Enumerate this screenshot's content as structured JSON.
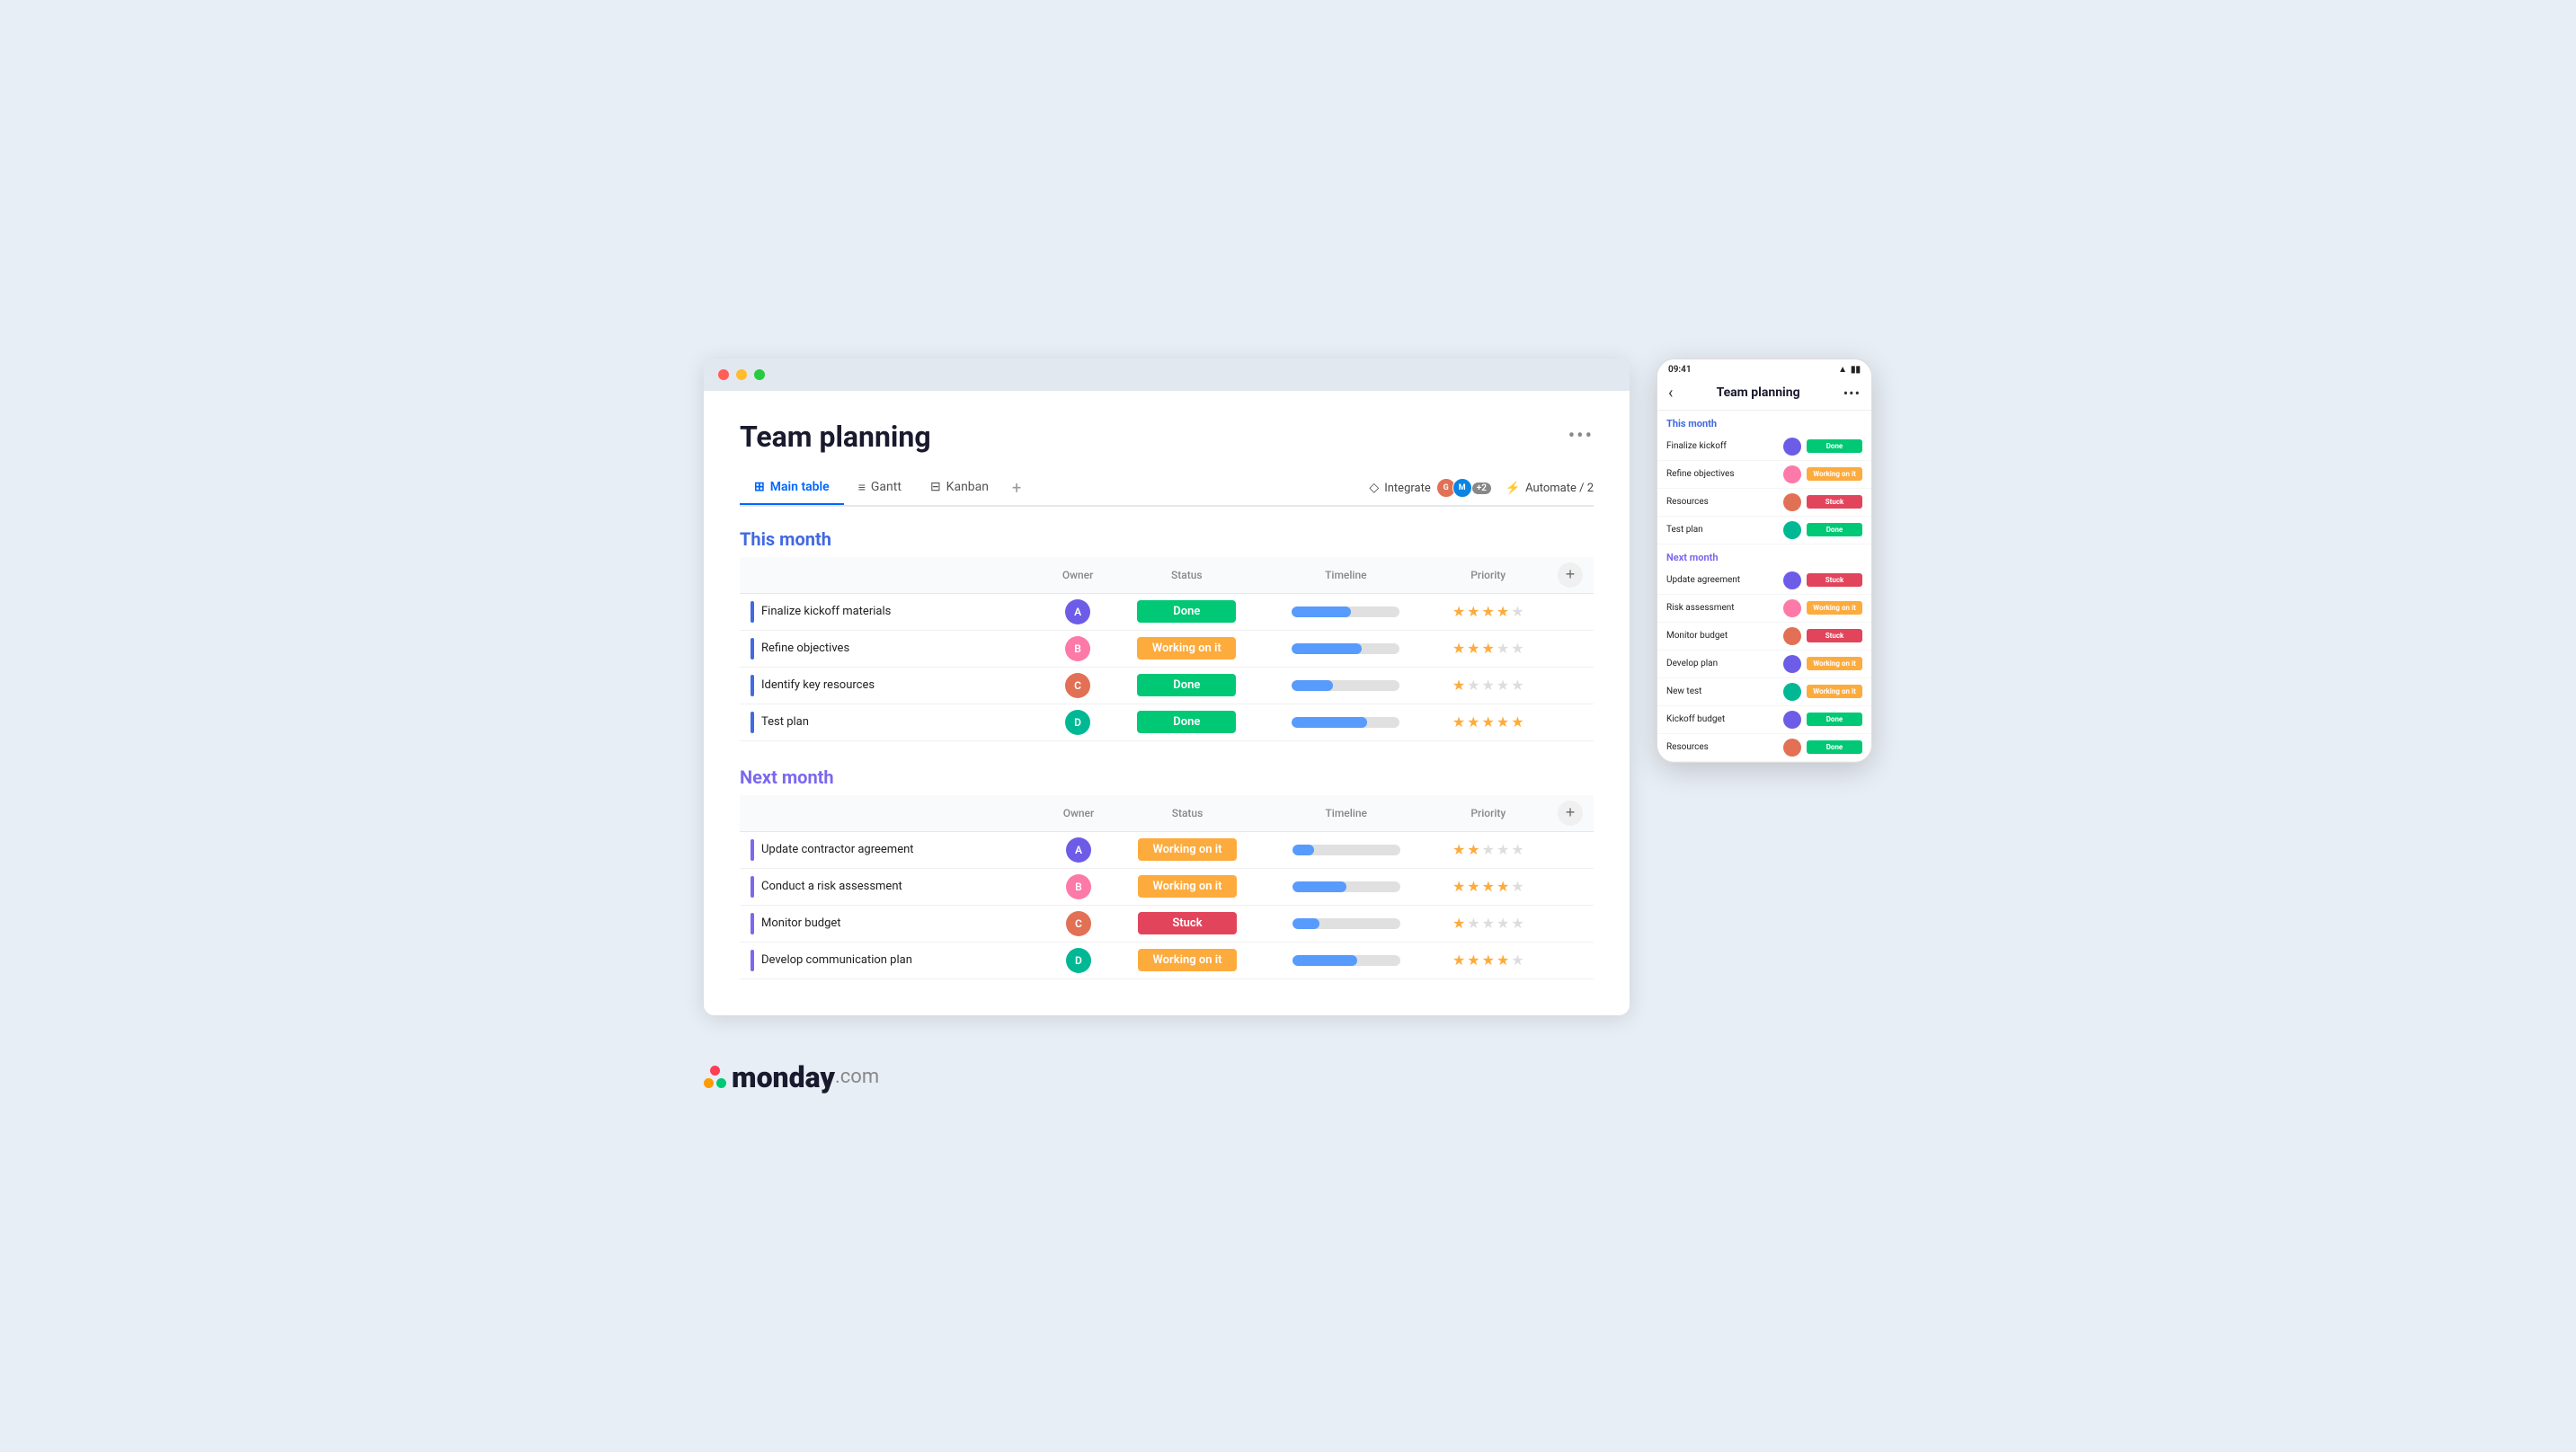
{
  "app": {
    "title": "Team planning",
    "more_label": "•••"
  },
  "tabs": [
    {
      "id": "main-table",
      "label": "Main table",
      "icon": "⊞",
      "active": true
    },
    {
      "id": "gantt",
      "label": "Gantt",
      "icon": "≡",
      "active": false
    },
    {
      "id": "kanban",
      "label": "Kanban",
      "icon": "⊟",
      "active": false
    }
  ],
  "toolbar_right": {
    "integrate_label": "Integrate",
    "plus_badge": "+2",
    "automate_label": "Automate / 2"
  },
  "this_month": {
    "section_label": "This month",
    "columns": [
      "Owner",
      "Status",
      "Timeline",
      "Priority"
    ],
    "rows": [
      {
        "task": "Finalize kickoff materials",
        "owner_color": "#6c5ce7",
        "owner_initials": "A",
        "status": "Done",
        "status_class": "status-done",
        "timeline_pct": 55,
        "stars": [
          1,
          1,
          1,
          1,
          0
        ]
      },
      {
        "task": "Refine objectives",
        "owner_color": "#fd79a8",
        "owner_initials": "B",
        "status": "Working on it",
        "status_class": "status-working",
        "timeline_pct": 65,
        "stars": [
          1,
          1,
          1,
          0,
          0
        ]
      },
      {
        "task": "Identify key resources",
        "owner_color": "#e17055",
        "owner_initials": "C",
        "status": "Done",
        "status_class": "status-done",
        "timeline_pct": 38,
        "stars": [
          1,
          0,
          0,
          0,
          0
        ]
      },
      {
        "task": "Test plan",
        "owner_color": "#00b894",
        "owner_initials": "D",
        "status": "Done",
        "status_class": "status-done",
        "timeline_pct": 70,
        "stars": [
          1,
          1,
          1,
          1,
          1
        ]
      }
    ]
  },
  "next_month": {
    "section_label": "Next month",
    "columns": [
      "Owner",
      "Status",
      "Timeline",
      "Priority"
    ],
    "rows": [
      {
        "task": "Update contractor agreement",
        "owner_color": "#6c5ce7",
        "owner_initials": "A",
        "status": "Working on it",
        "status_class": "status-working",
        "timeline_pct": 20,
        "stars": [
          1,
          1,
          0,
          0,
          0
        ]
      },
      {
        "task": "Conduct a risk assessment",
        "owner_color": "#fd79a8",
        "owner_initials": "B",
        "status": "Working on it",
        "status_class": "status-working",
        "timeline_pct": 50,
        "stars": [
          1,
          1,
          1,
          1,
          0
        ]
      },
      {
        "task": "Monitor budget",
        "owner_color": "#e17055",
        "owner_initials": "C",
        "status": "Stuck",
        "status_class": "status-stuck",
        "timeline_pct": 25,
        "stars": [
          1,
          0,
          0,
          0,
          0
        ]
      },
      {
        "task": "Develop communication plan",
        "owner_color": "#00b894",
        "owner_initials": "D",
        "status": "Working on it",
        "status_class": "status-working",
        "timeline_pct": 60,
        "stars": [
          1,
          1,
          1,
          1,
          0
        ]
      }
    ]
  },
  "phone": {
    "time": "09:41",
    "title": "Team planning",
    "this_month_label": "This month",
    "next_month_label": "Next month",
    "this_month_rows": [
      {
        "task": "Finalize kickoff",
        "owner_color": "#6c5ce7",
        "status": "Done",
        "status_class": "phone-status-done"
      },
      {
        "task": "Refine objectives",
        "owner_color": "#fd79a8",
        "status": "Working on it",
        "status_class": "phone-status-working"
      },
      {
        "task": "Resources",
        "owner_color": "#e17055",
        "status": "Stuck",
        "status_class": "phone-status-stuck"
      },
      {
        "task": "Test plan",
        "owner_color": "#00b894",
        "status": "Done",
        "status_class": "phone-status-done"
      }
    ],
    "next_month_rows": [
      {
        "task": "Update agreement",
        "owner_color": "#6c5ce7",
        "status": "Stuck",
        "status_class": "phone-status-stuck"
      },
      {
        "task": "Risk assessment",
        "owner_color": "#fd79a8",
        "status": "Working on it",
        "status_class": "phone-status-working"
      },
      {
        "task": "Monitor budget",
        "owner_color": "#e17055",
        "status": "Stuck",
        "status_class": "phone-status-stuck"
      },
      {
        "task": "Develop plan",
        "owner_color": "#6c5ce7",
        "status": "Working on it",
        "status_class": "phone-status-working"
      },
      {
        "task": "New test",
        "owner_color": "#00b894",
        "status": "Working on it",
        "status_class": "phone-status-working"
      },
      {
        "task": "Kickoff budget",
        "owner_color": "#6c5ce7",
        "status": "Done",
        "status_class": "phone-status-done"
      },
      {
        "task": "Resources",
        "owner_color": "#e17055",
        "status": "Done",
        "status_class": "phone-status-done"
      }
    ]
  },
  "logo": {
    "monday_label": "monday",
    "com_label": ".com",
    "dot_colors": [
      "#ff3d57",
      "#ff9a00",
      "#00c875"
    ]
  }
}
